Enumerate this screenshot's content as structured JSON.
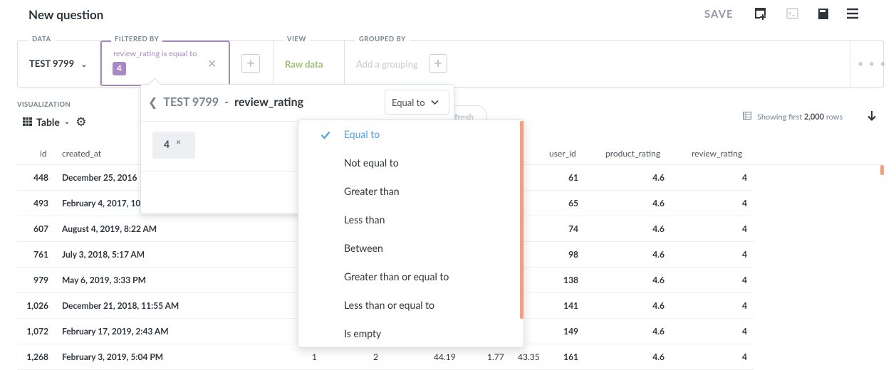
{
  "header": {
    "title": "New question",
    "save_label": "SAVE",
    "icons": [
      "add-to-dashboard-icon",
      "sql-editor-icon",
      "bookmark-icon",
      "menu-icon"
    ]
  },
  "query_builder": {
    "data_label": "DATA",
    "data_value": "TEST 9799",
    "filter_label": "FILTERED BY",
    "filter_text": "review_rating is equal to",
    "filter_value": "4",
    "view_label": "VIEW",
    "view_value": "Raw data",
    "group_label": "GROUPED BY",
    "group_placeholder": "Add a grouping"
  },
  "visualization": {
    "label": "VISUALIZATION",
    "type": "Table",
    "rows_info_prefix": "Showing first ",
    "rows_info_count": "2,000",
    "rows_info_suffix": " rows",
    "refresh_label": "fresh"
  },
  "table": {
    "columns": [
      "id",
      "created_at",
      "user_id",
      "product_rating",
      "review_rating"
    ],
    "rows": [
      {
        "id": "448",
        "created_at": "December 25, 2016",
        "user_id": "61",
        "product_rating": "4.6",
        "review_rating": "4"
      },
      {
        "id": "493",
        "created_at": "February 4, 2017, 10",
        "user_id": "65",
        "product_rating": "4.6",
        "review_rating": "4"
      },
      {
        "id": "607",
        "created_at": "August 4, 2019, 8:22 AM",
        "user_id": "74",
        "product_rating": "4.6",
        "review_rating": "4"
      },
      {
        "id": "761",
        "created_at": "July 3, 2018, 5:17 AM",
        "user_id": "98",
        "product_rating": "4.6",
        "review_rating": "4"
      },
      {
        "id": "979",
        "created_at": "May 6, 2019, 3:33 PM",
        "user_id": "138",
        "product_rating": "4.6",
        "review_rating": "4"
      },
      {
        "id": "1,026",
        "created_at": "December 21, 2018, 11:55 AM",
        "user_id": "141",
        "product_rating": "4.6",
        "review_rating": "4"
      },
      {
        "id": "1,072",
        "created_at": "February 17, 2019, 2:43 AM",
        "user_id": "149",
        "product_rating": "4.6",
        "review_rating": "4"
      },
      {
        "id": "1,268",
        "created_at": "February 3, 2019, 5:04 PM",
        "user_id": "161",
        "product_rating": "4.6",
        "review_rating": "4"
      }
    ],
    "partial_row_extra": [
      "1",
      "2",
      "44.19",
      "1.77",
      "43.35"
    ]
  },
  "filter_popover": {
    "table_name": "TEST 9799",
    "separator": "-",
    "field_name": "review_rating",
    "operator_selected": "Equal to",
    "value": "4",
    "value_remove": "×"
  },
  "operator_dropdown": {
    "options": [
      "Equal to",
      "Not equal to",
      "Greater than",
      "Less than",
      "Between",
      "Greater than or equal to",
      "Less than or equal to",
      "Is empty"
    ]
  },
  "colors": {
    "filter_purple": "#a989c5",
    "view_green": "#9cc177",
    "brand_blue": "#509ee3",
    "scroll_orange": "#f2a07e"
  }
}
